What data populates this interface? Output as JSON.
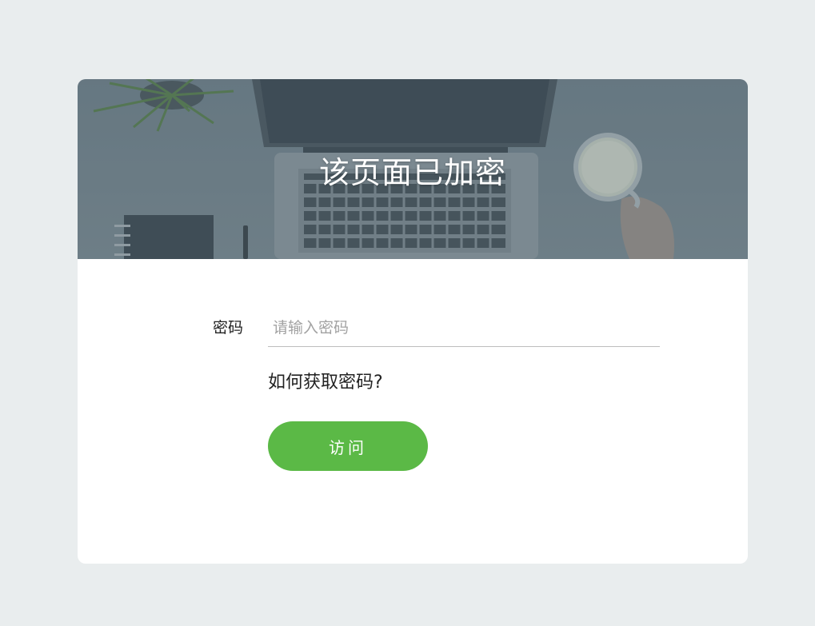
{
  "banner": {
    "title": "该页面已加密"
  },
  "form": {
    "password_label": "密码",
    "password_placeholder": "请输入密码",
    "password_value": "",
    "help_link": "如何获取密码?",
    "submit_label": "访问"
  },
  "colors": {
    "page_bg": "#e9edee",
    "card_bg": "#ffffff",
    "button": "#5bb946"
  },
  "icons": [
    "laptop-illustration",
    "plant-illustration",
    "coffee-cup-illustration",
    "notebook-illustration",
    "pen-illustration"
  ]
}
